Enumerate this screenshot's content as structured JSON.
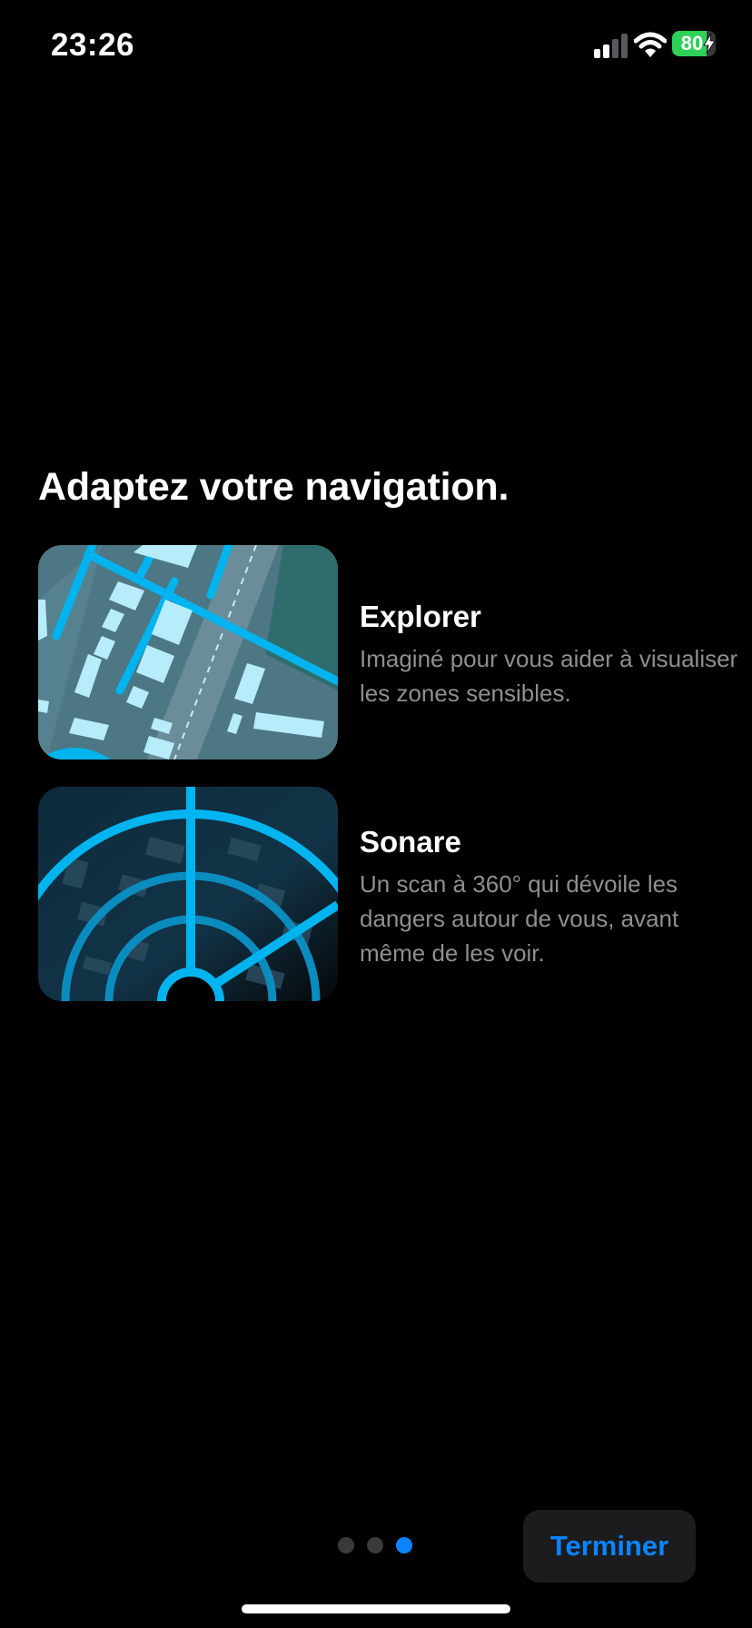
{
  "status_bar": {
    "time": "23:26",
    "battery_label": "80",
    "battery_level": 0.8,
    "battery_color": "#30d158",
    "icons": [
      "signal-icon",
      "wifi-icon",
      "battery-icon",
      "charging-bolt-icon"
    ]
  },
  "headline": "Adaptez votre navigation.",
  "features": [
    {
      "image": "explorer-map-illustration",
      "title": "Explorer",
      "description": "Imaginé pour vous aider à visualiser les zones sensibles."
    },
    {
      "image": "sonar-radar-illustration",
      "title": "Sonare",
      "description": "Un scan à 360° qui dévoile les dangers autour de vous, avant même de les voir."
    }
  ],
  "pager": {
    "count": 3,
    "current": 3
  },
  "actions": {
    "done_label": "Terminer"
  },
  "colors": {
    "accent": "#0a84ff",
    "illustration_cyan": "#00b4f0"
  }
}
